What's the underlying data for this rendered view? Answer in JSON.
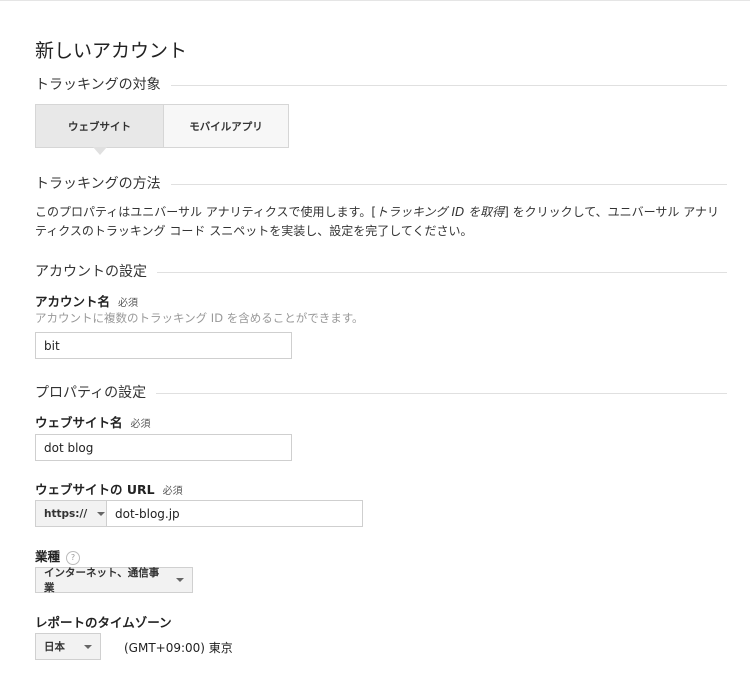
{
  "page_title": "新しいアカウント",
  "sections": {
    "tracking_target": "トラッキングの対象",
    "tracking_method": "トラッキングの方法",
    "account_settings": "アカウントの設定",
    "property_settings": "プロパティの設定"
  },
  "tabs": [
    {
      "label": "ウェブサイト",
      "active": true
    },
    {
      "label": "モバイルアプリ",
      "active": false
    }
  ],
  "description": {
    "line1_pre": "このプロパティはユニバーサル アナリティクスで使用します。[",
    "line1_italic": "トラッキング ID を取得",
    "line1_post": "] をクリックして、ユニバーサル アナリ",
    "line2": "ティクスのトラッキング コード スニペットを実装し、設定を完了してください。"
  },
  "account": {
    "label": "アカウント名",
    "required": "必須",
    "hint": "アカウントに複数のトラッキング ID を含めることができます。",
    "value": "bit"
  },
  "website_name": {
    "label": "ウェブサイト名",
    "required": "必須",
    "value": "dot blog"
  },
  "website_url": {
    "label": "ウェブサイトの URL",
    "required": "必須",
    "protocol": "https://",
    "value": "dot-blog.jp"
  },
  "industry": {
    "label": "業種",
    "help": "?",
    "value": "インターネット、通信事業"
  },
  "timezone": {
    "label": "レポートのタイムゾーン",
    "country": "日本",
    "zone": "(GMT+09:00) 東京"
  }
}
